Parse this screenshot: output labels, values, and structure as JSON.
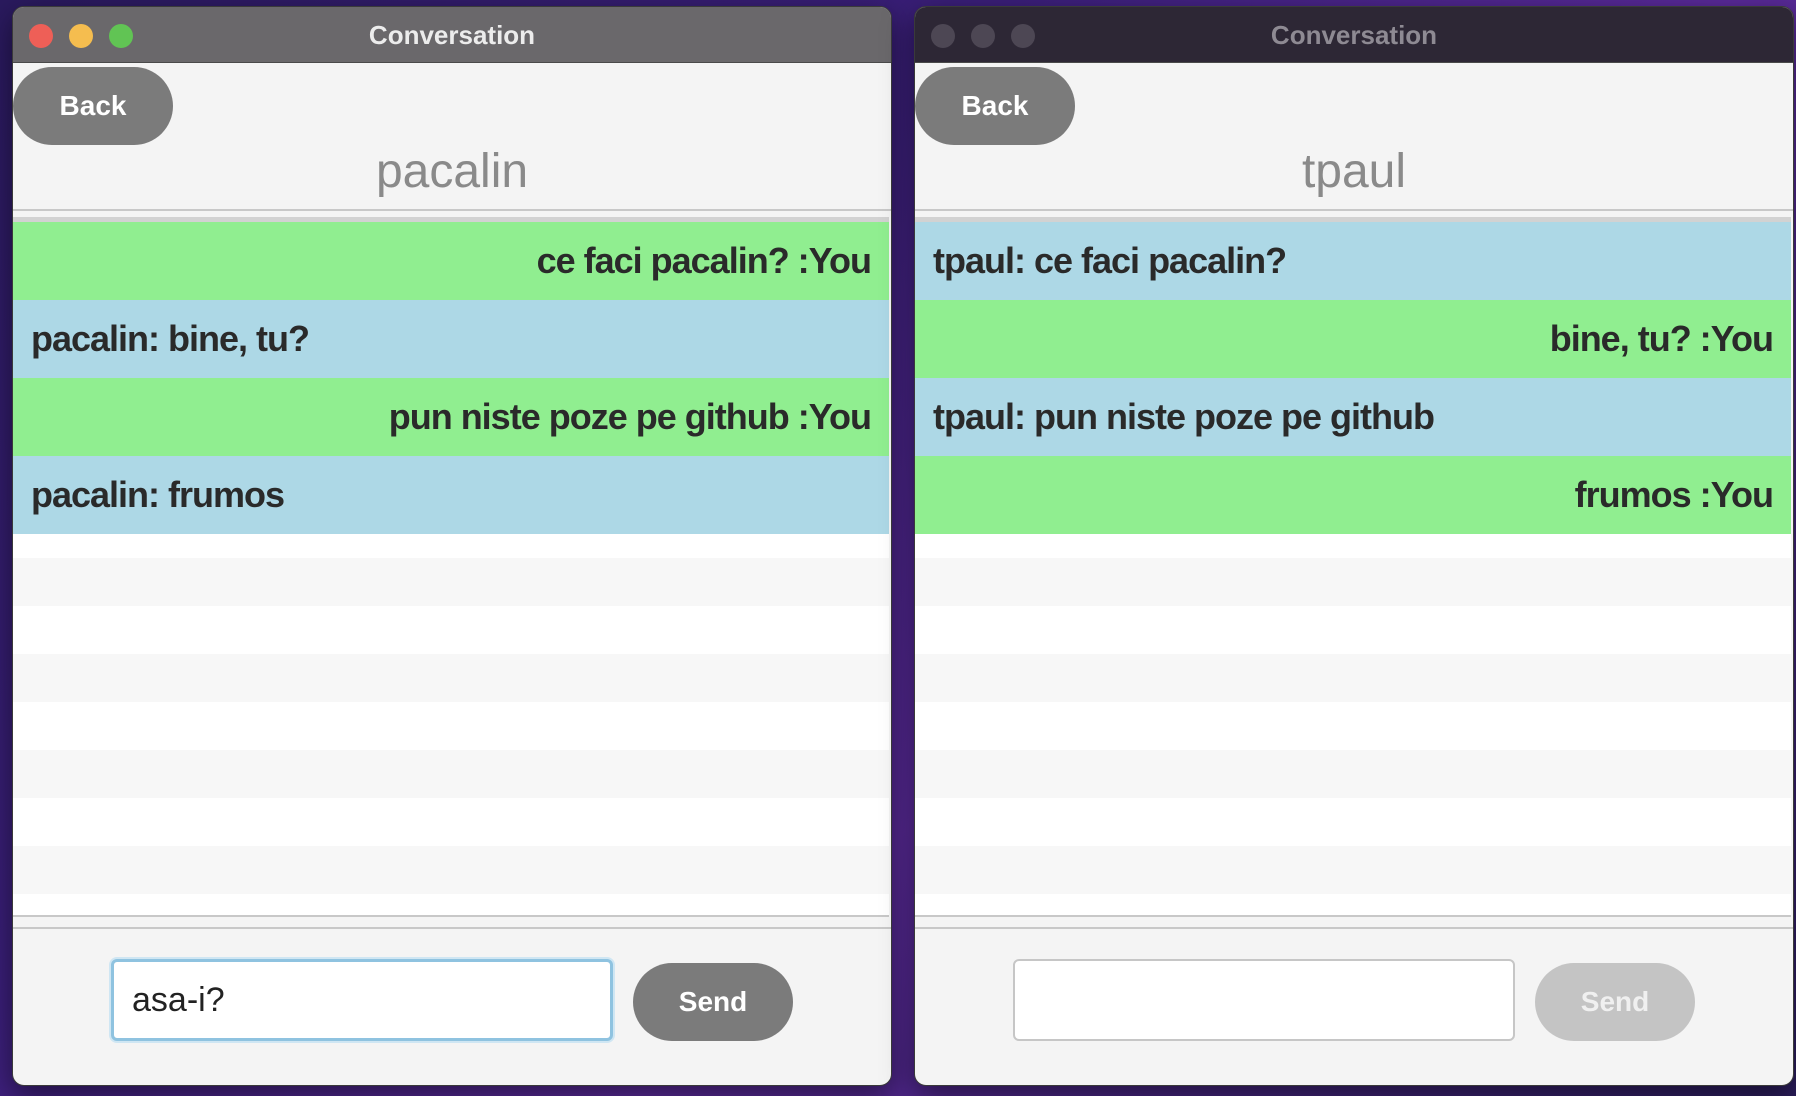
{
  "windows": [
    {
      "title": "Conversation",
      "active": true,
      "back_label": "Back",
      "contact": "pacalin",
      "messages": [
        {
          "text": "ce faci pacalin? :You",
          "mine": true
        },
        {
          "text": "pacalin: bine, tu?",
          "mine": false
        },
        {
          "text": "pun niste poze pe github :You",
          "mine": true
        },
        {
          "text": "pacalin: frumos",
          "mine": false
        }
      ],
      "input_value": "asa-i?",
      "send_label": "Send",
      "send_enabled": true
    },
    {
      "title": "Conversation",
      "active": false,
      "back_label": "Back",
      "contact": "tpaul",
      "messages": [
        {
          "text": "tpaul: ce faci pacalin?",
          "mine": false
        },
        {
          "text": "bine, tu? :You",
          "mine": true
        },
        {
          "text": "tpaul: pun niste poze pe github",
          "mine": false
        },
        {
          "text": "frumos :You",
          "mine": true
        }
      ],
      "input_value": "",
      "send_label": "Send",
      "send_enabled": false
    }
  ],
  "colors": {
    "mine_bg": "#90ee90",
    "theirs_bg": "#add8e6",
    "button_bg": "#7b7b7b",
    "button_disabled_bg": "#c4c4c4"
  }
}
